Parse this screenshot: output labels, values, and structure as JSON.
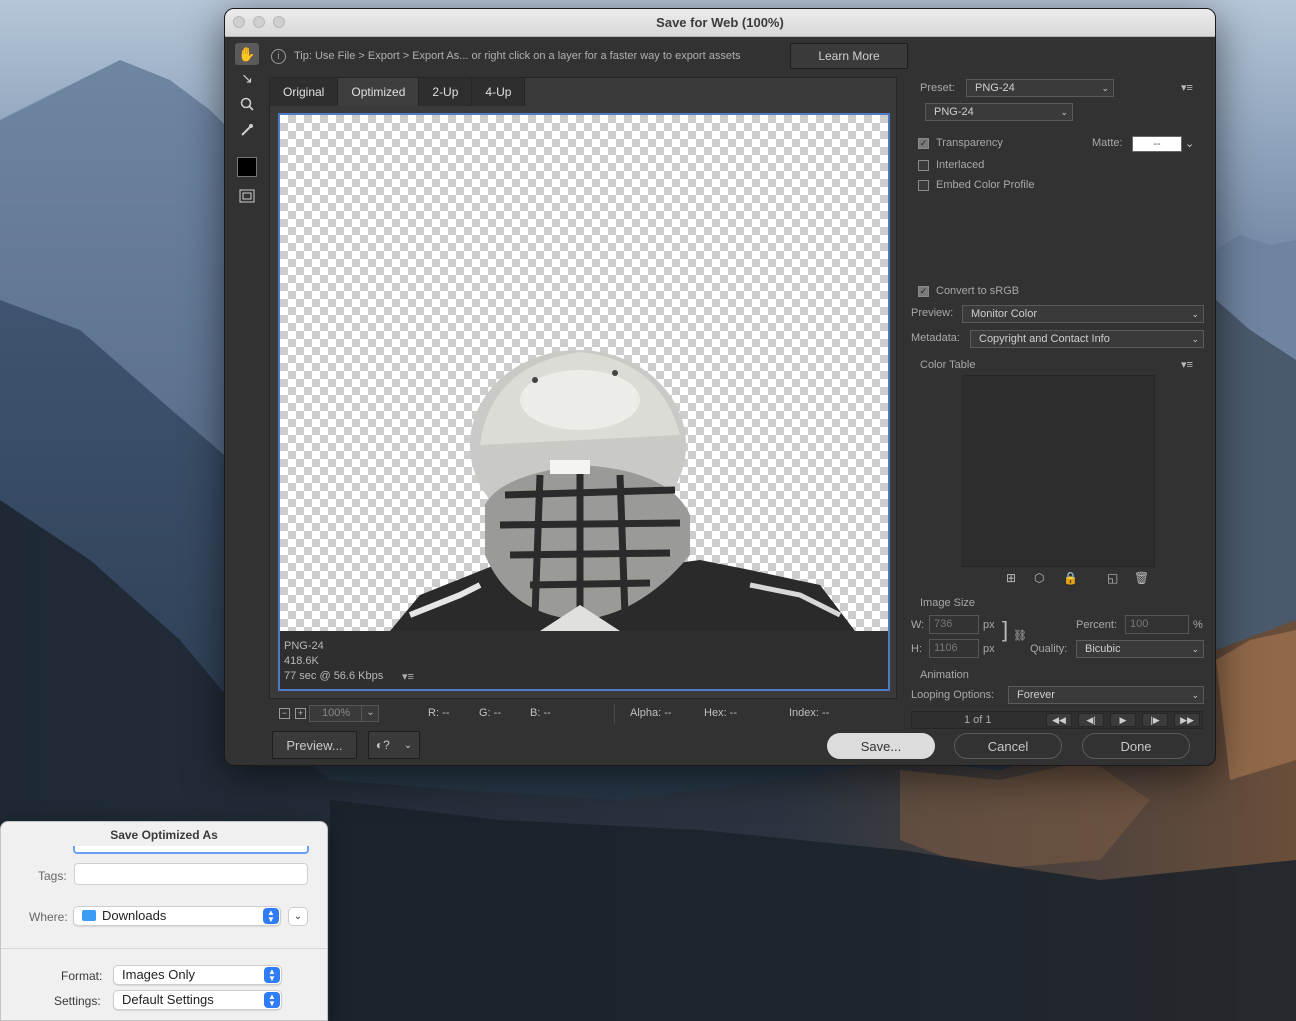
{
  "window": {
    "title": "Save for Web (100%)"
  },
  "tip": {
    "text": "Tip: Use File > Export > Export As... or right click on a layer for a faster way to export assets",
    "learn_more": "Learn More"
  },
  "tabs": [
    {
      "label": "Original"
    },
    {
      "label": "Optimized"
    },
    {
      "label": "2-Up"
    },
    {
      "label": "4-Up"
    }
  ],
  "optimized_info": {
    "format": "PNG-24",
    "size": "418.6K",
    "time": "77 sec @ 56.6 Kbps"
  },
  "status": {
    "zoom": "100%",
    "r": "R: --",
    "g": "G: --",
    "b": "B: --",
    "alpha": "Alpha: --",
    "hex": "Hex: --",
    "index": "Index: --"
  },
  "buttons": {
    "preview": "Preview...",
    "save": "Save...",
    "cancel": "Cancel",
    "done": "Done"
  },
  "settings": {
    "preset_label": "Preset:",
    "preset_value": "PNG-24",
    "format_value": "PNG-24",
    "transparency": "Transparency",
    "matte_label": "Matte:",
    "matte_value": "--",
    "interlaced": "Interlaced",
    "embed_profile": "Embed Color Profile",
    "convert_srgb": "Convert to sRGB",
    "preview_label": "Preview:",
    "preview_value": "Monitor Color",
    "metadata_label": "Metadata:",
    "metadata_value": "Copyright and Contact Info",
    "color_table": "Color Table"
  },
  "image_size": {
    "title": "Image Size",
    "w_label": "W:",
    "w_value": "736",
    "h_label": "H:",
    "h_value": "1106",
    "px": "px",
    "percent_label": "Percent:",
    "percent_value": "100",
    "percent_unit": "%",
    "quality_label": "Quality:",
    "quality_value": "Bicubic"
  },
  "animation": {
    "title": "Animation",
    "looping_label": "Looping Options:",
    "looping_value": "Forever",
    "frame": "1 of 1"
  },
  "save_sheet": {
    "title": "Save Optimized As",
    "tags_label": "Tags:",
    "where_label": "Where:",
    "where_value": "Downloads",
    "format_label": "Format:",
    "format_value": "Images Only",
    "settings_label": "Settings:",
    "settings_value": "Default Settings"
  }
}
